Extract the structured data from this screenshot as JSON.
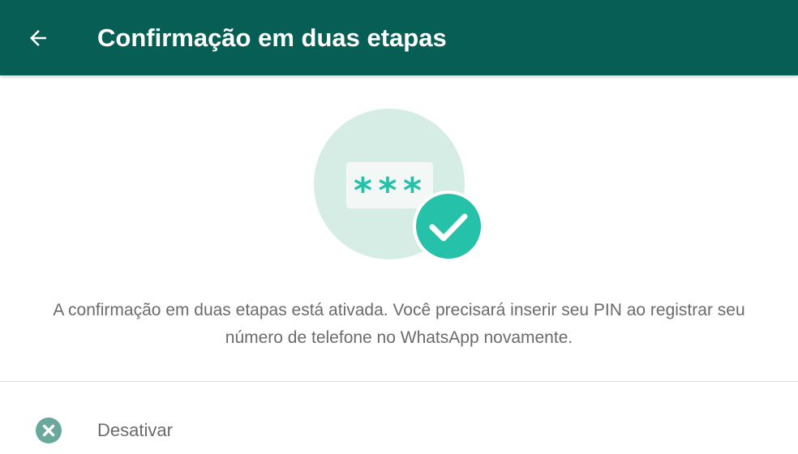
{
  "header": {
    "title": "Confirmação em duas etapas",
    "back_icon": "arrow-back-icon"
  },
  "hero": {
    "pin_mask": "***",
    "illustration_icon": "pin-check-illustration"
  },
  "status": {
    "description": "A confirmação em duas etapas está ativada. Você precisará inserir seu PIN ao registrar seu número de telefone no WhatsApp novamente."
  },
  "actions": {
    "disable_label": "Desativar",
    "disable_icon": "close-circle-icon"
  },
  "colors": {
    "toolbar": "#075e54",
    "accent": "#25c1a9",
    "hero_circle": "#d6ede6",
    "text_secondary": "#6b6b6b",
    "icon_secondary": "#6aa89c"
  }
}
